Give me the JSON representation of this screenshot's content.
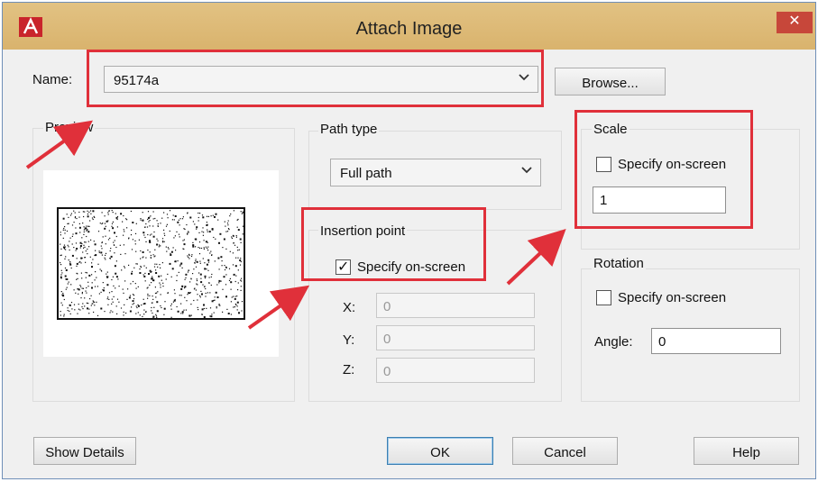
{
  "window": {
    "title": "Attach Image",
    "close_glyph": "✕",
    "app_icon": "autocad-logo-icon"
  },
  "name_row": {
    "label": "Name:",
    "value": "95174a",
    "browse_label": "Browse..."
  },
  "preview": {
    "label": "Preview"
  },
  "path_type": {
    "label": "Path type",
    "value": "Full path"
  },
  "insertion": {
    "label": "Insertion point",
    "specify_label": "Specify on-screen",
    "specify_checked": true,
    "x_label": "X:",
    "x_value": "0",
    "y_label": "Y:",
    "y_value": "0",
    "z_label": "Z:",
    "z_value": "0"
  },
  "scale": {
    "label": "Scale",
    "specify_label": "Specify on-screen",
    "specify_checked": false,
    "value": "1"
  },
  "rotation": {
    "label": "Rotation",
    "specify_label": "Specify on-screen",
    "specify_checked": false,
    "angle_label": "Angle:",
    "angle_value": "0"
  },
  "buttons": {
    "show_details": "Show Details",
    "ok": "OK",
    "cancel": "Cancel",
    "help": "Help"
  },
  "colors": {
    "highlight": "#e0303a",
    "titlebar": "#ddb978",
    "close": "#c7473a"
  }
}
